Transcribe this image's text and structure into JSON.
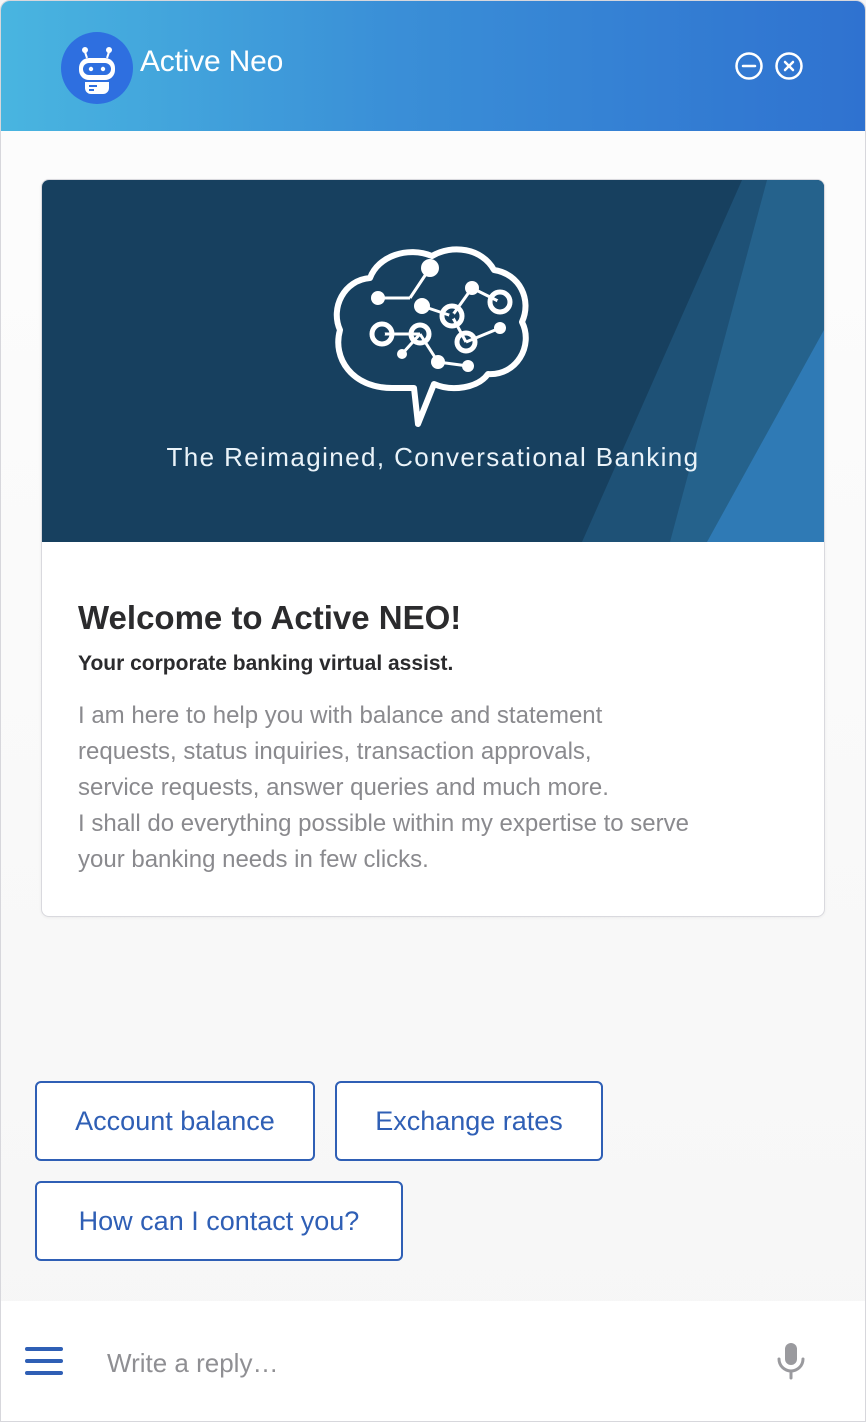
{
  "header": {
    "title": "Active Neo",
    "brand_color": "#2f72d0"
  },
  "card": {
    "tagline": "The Reimagined, Conversational Banking",
    "welcome": "Welcome to Active NEO!",
    "subtitle": "Your corporate banking virtual assist.",
    "description_lines": [
      "I am here to help you with balance and statement",
      "requests, status inquiries, transaction approvals,",
      "service requests, answer queries and much more.",
      "I shall do everything possible within my expertise to serve",
      "your banking needs in few clicks."
    ]
  },
  "quick_replies": [
    {
      "label": "Account balance"
    },
    {
      "label": "Exchange rates"
    },
    {
      "label": "How can I contact you?"
    }
  ],
  "composer": {
    "placeholder": "Write a reply…",
    "value": ""
  },
  "icons": {
    "avatar": "robot-icon",
    "minimize": "minus-circle-icon",
    "close": "close-circle-icon",
    "menu": "hamburger-menu-icon",
    "mic": "microphone-icon",
    "banner": "brain-circuit-icon"
  },
  "colors": {
    "accent": "#2f5fb5",
    "banner_bg": "#17405f"
  }
}
